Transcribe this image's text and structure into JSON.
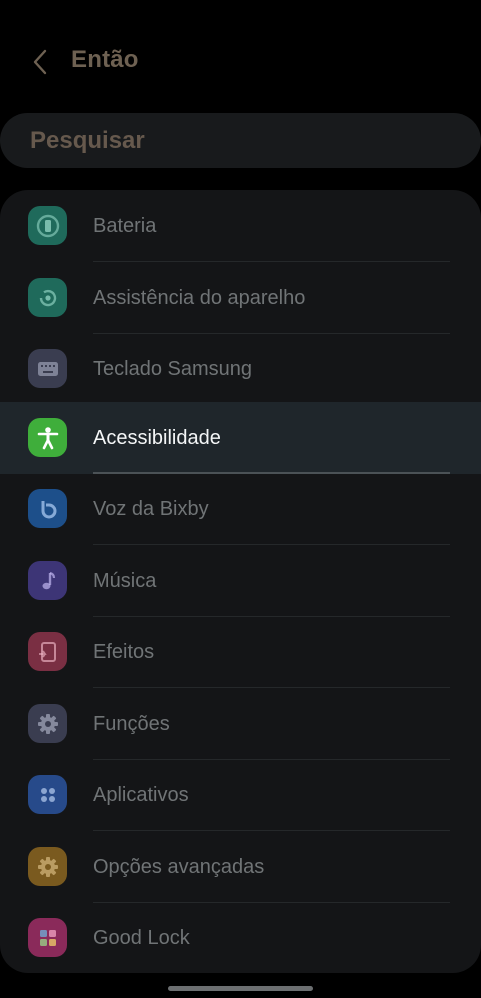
{
  "header": {
    "back_icon": "chevron-left-icon",
    "title": "Então"
  },
  "search": {
    "text": "Pesquisar"
  },
  "colors": {
    "background": "#000000",
    "panel": "#141517",
    "active_row": "#1f262b",
    "title_text": "#6e6152",
    "item_text": "#707476",
    "active_text": "#f4f6f7"
  },
  "settings": {
    "items": [
      {
        "label": "Bateria",
        "icon": "battery-icon",
        "color": "#1f6a5b",
        "active": false
      },
      {
        "label": "Assistência do aparelho",
        "icon": "device-care-icon",
        "color": "#1f6a5b",
        "active": false
      },
      {
        "label": "Teclado Samsung",
        "icon": "keyboard-icon",
        "color": "#3a3d50",
        "active": false
      },
      {
        "label": "Acessibilidade",
        "icon": "accessibility-icon",
        "color": "#3fae3b",
        "active": true
      },
      {
        "label": "Voz da Bixby",
        "icon": "bixby-icon",
        "color": "#1d4f8a",
        "active": false
      },
      {
        "label": "Música",
        "icon": "music-note-icon",
        "color": "#3d3576",
        "active": false
      },
      {
        "label": "Efeitos",
        "icon": "effects-icon",
        "color": "#7a2f43",
        "active": false
      },
      {
        "label": "Funções",
        "icon": "gear-icon",
        "color": "#3a3d50",
        "active": false
      },
      {
        "label": "Aplicativos",
        "icon": "apps-icon",
        "color": "#274a8a",
        "active": false
      },
      {
        "label": "Opções avançadas",
        "icon": "advanced-gear-icon",
        "color": "#7a5a1f",
        "active": false
      },
      {
        "label": "Good Lock",
        "icon": "good-lock-icon",
        "color": "#8a2a5a",
        "active": false
      }
    ]
  }
}
